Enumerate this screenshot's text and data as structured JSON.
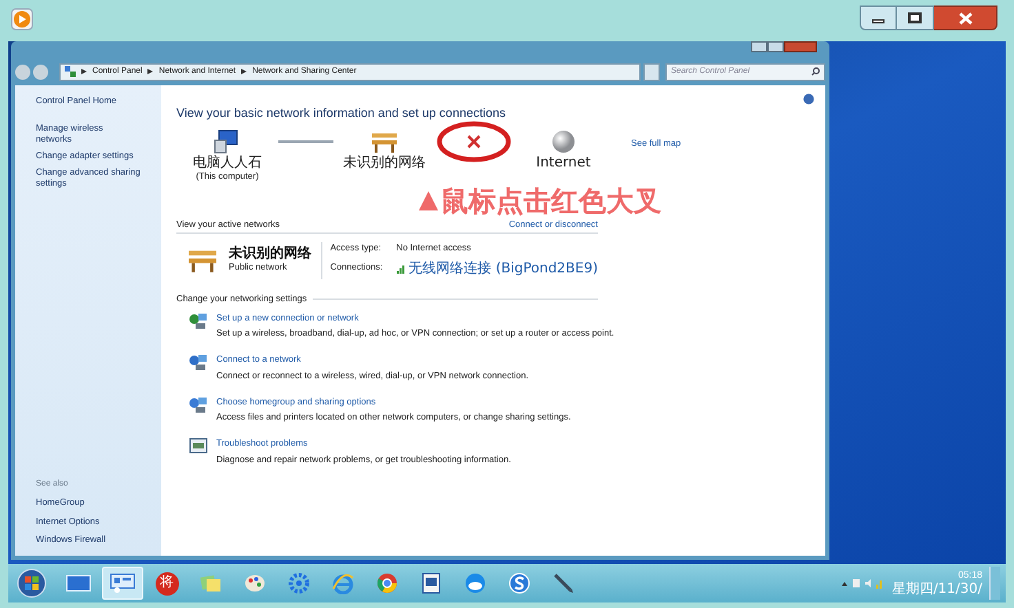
{
  "address": {
    "crumbs": [
      "Control Panel",
      "Network and Internet",
      "Network and Sharing Center"
    ],
    "search_placeholder": "Search Control Panel"
  },
  "sidebar": {
    "links": [
      "Control Panel Home",
      "Manage wireless networks",
      "Change adapter settings",
      "Change advanced sharing settings"
    ],
    "see_also_title": "See also",
    "see_also": [
      "HomeGroup",
      "Internet Options",
      "Windows Firewall"
    ]
  },
  "map": {
    "heading": "View your basic network information and set up connections",
    "see_full_map": "See full map",
    "nodes": [
      {
        "kind": "computer",
        "label": "电脑人人石",
        "sublabel": "(This computer)"
      },
      {
        "kind": "network",
        "label": "未识别的网络"
      },
      {
        "kind": "internet",
        "label": "Internet"
      }
    ],
    "links": [
      {
        "broken": false
      },
      {
        "broken": true
      }
    ]
  },
  "active": {
    "title": "View your active networks",
    "connect_link": "Connect or disconnect",
    "name": "未识别的网络",
    "type": "Public network",
    "access_label": "Access type:",
    "access_value": "No Internet access",
    "connections_label": "Connections:",
    "connection": "无线网络连接 (BigPond2BE9)"
  },
  "settings": {
    "title": "Change your networking settings",
    "items": [
      {
        "kind": "new",
        "link": "Set up a new connection or network",
        "desc": "Set up a wireless, broadband, dial-up, ad hoc, or VPN connection; or set up a router or access point."
      },
      {
        "kind": "connect",
        "link": "Connect to a network",
        "desc": "Connect or reconnect to a wireless, wired, dial-up, or VPN network connection."
      },
      {
        "kind": "homegroup",
        "link": "Choose homegroup and sharing options",
        "desc": "Access files and printers located on other network computers, or change sharing settings."
      },
      {
        "kind": "troubleshoot",
        "link": "Troubleshoot problems",
        "desc": "Diagnose and repair network problems, or get troubleshooting information."
      }
    ]
  },
  "annotation": {
    "text": "鼠标点击红色大叉"
  },
  "taskbar": {
    "apps": [
      {
        "kind": "desktop",
        "selected": false
      },
      {
        "kind": "control",
        "selected": true
      },
      {
        "kind": "glyph",
        "label": "将",
        "selected": false
      },
      {
        "kind": "notes",
        "selected": false
      },
      {
        "kind": "paint",
        "selected": false
      },
      {
        "kind": "gear",
        "selected": false
      },
      {
        "kind": "ie",
        "selected": false
      },
      {
        "kind": "chrome",
        "selected": false
      },
      {
        "kind": "word",
        "selected": false
      },
      {
        "kind": "cloud",
        "selected": false
      },
      {
        "kind": "sogou",
        "selected": false
      },
      {
        "kind": "pen",
        "selected": false
      }
    ],
    "time": "05:18",
    "date": "星期四/11/30/"
  }
}
